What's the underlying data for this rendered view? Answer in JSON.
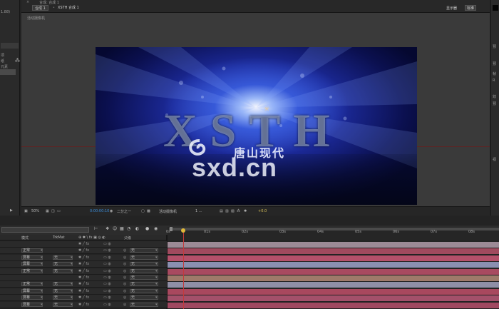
{
  "left_panel": {
    "items": [
      "1.88)",
      "项",
      "纸",
      "元素",
      "机"
    ]
  },
  "comp_panel": {
    "top_title": "合成: 合成 1",
    "tabs": [
      "合成 1",
      "XSTH 合成 1"
    ],
    "active_camera_label": "活动摄像机",
    "workspace_label": "显示器",
    "workspace_value": "标准"
  },
  "viewport": {
    "logo_text": "XSTH",
    "logo_sub": "唐山现代",
    "watermark": "sxd.cn"
  },
  "comp_toolbar": {
    "zoom": "50%",
    "timecode": "0:00:00:10",
    "resolution": "二分之一",
    "camera": "活动摄像机",
    "views": "1 ...",
    "exposure": "+0.0"
  },
  "right_panel": {
    "items": [
      "预",
      "预",
      "帧",
      "R",
      "效",
      "预",
      "视"
    ]
  },
  "timeline": {
    "columns": {
      "mode": "模式",
      "trkmat": "TrkMat",
      "parent": "父级"
    },
    "ruler_ticks": [
      "0s",
      "01s",
      "02s",
      "03s",
      "04s",
      "05s",
      "06s",
      "07s",
      "08s"
    ],
    "layers": [
      {
        "mode": "",
        "trkmat": "",
        "parent": ""
      },
      {
        "mode": "正常",
        "trkmat": "",
        "parent": "无"
      },
      {
        "mode": "屏幕",
        "trkmat": "无",
        "parent": "无"
      },
      {
        "mode": "屏幕",
        "trkmat": "无",
        "parent": "无"
      },
      {
        "mode": "正常",
        "trkmat": "无",
        "parent": "无"
      },
      {
        "mode": "",
        "trkmat": "",
        "parent": "无"
      },
      {
        "mode": "正常",
        "trkmat": "无",
        "parent": "无"
      },
      {
        "mode": "屏幕",
        "trkmat": "无",
        "parent": "无"
      },
      {
        "mode": "屏幕",
        "trkmat": "无",
        "parent": "无"
      },
      {
        "mode": "屏幕",
        "trkmat": "无",
        "parent": "无"
      }
    ],
    "bar_colors": [
      "#9c8a96",
      "#a04a5e",
      "#b4506a",
      "#8a8fb0",
      "#a84a60",
      "#9e7a6a",
      "#8f8fa6",
      "#a8485e",
      "#a3506a",
      "#a04860"
    ]
  },
  "colors": {
    "accent_blue": "#3a8cd8",
    "playhead": "#e0b83a",
    "exposure": "#d8c15a"
  }
}
